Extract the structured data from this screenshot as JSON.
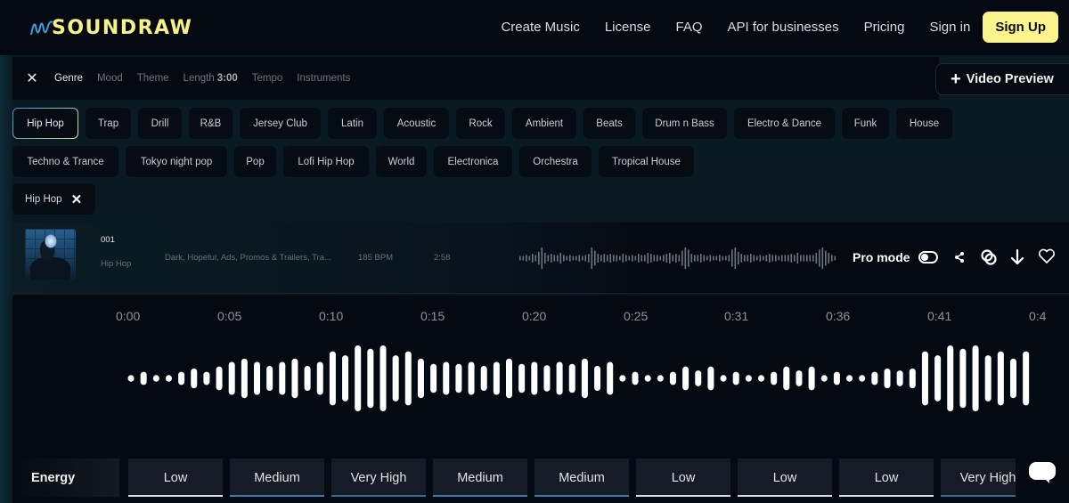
{
  "header": {
    "brand": "SOUNDRAW",
    "nav": [
      "Create Music",
      "License",
      "FAQ",
      "API for businesses",
      "Pricing",
      "Sign in"
    ],
    "signup_label": "Sign Up"
  },
  "filters": {
    "close_icon": "close-icon",
    "tabs": [
      {
        "label": "Genre",
        "active": true
      },
      {
        "label": "Mood",
        "active": false
      },
      {
        "label": "Theme",
        "active": false
      },
      {
        "label": "Length",
        "value": "3:00",
        "active": false
      },
      {
        "label": "Tempo",
        "active": false
      },
      {
        "label": "Instruments",
        "active": false
      }
    ],
    "video_preview_label": "Video Preview"
  },
  "genres": {
    "row1": [
      "Hip Hop",
      "Trap",
      "Drill",
      "R&B",
      "Jersey Club",
      "Latin",
      "Acoustic",
      "Rock",
      "Ambient",
      "Beats",
      "Drum n Bass",
      "Electro & Dance",
      "Funk",
      "House"
    ],
    "row2": [
      "Techno & Trance",
      "Tokyo night pop",
      "Pop",
      "Lofi Hip Hop",
      "World",
      "Electronica",
      "Orchestra",
      "Tropical House"
    ],
    "selected": "Hip Hop"
  },
  "selected_filter": {
    "label": "Hip Hop"
  },
  "track": {
    "id": "001",
    "genre": "Hip Hop",
    "tags": "Dark, Hopeful, Ads, Promos & Trailers, Tra...",
    "bpm": "185 BPM",
    "duration": "2:58",
    "pro_mode_label": "Pro mode",
    "pro_mode_on": false
  },
  "timeline": {
    "labels": [
      "0:00",
      "0:05",
      "0:10",
      "0:15",
      "0:20",
      "0:25",
      "0:31",
      "0:36",
      "0:41",
      "0:4"
    ]
  },
  "waveform": {
    "amplitudes": [
      0.1,
      0.2,
      0.1,
      0.1,
      0.2,
      0.3,
      0.2,
      0.36,
      0.5,
      0.6,
      0.5,
      0.38,
      0.5,
      0.6,
      0.38,
      0.5,
      0.82,
      0.7,
      1.0,
      0.9,
      1.0,
      0.7,
      0.82,
      0.6,
      0.44,
      0.5,
      0.44,
      0.5,
      0.38,
      0.5,
      0.6,
      0.44,
      0.5,
      0.4,
      0.5,
      0.44,
      0.6,
      0.38,
      0.5,
      0.1,
      0.2,
      0.1,
      0.1,
      0.2,
      0.36,
      0.24,
      0.36,
      0.1,
      0.2,
      0.1,
      0.1,
      0.2,
      0.36,
      0.24,
      0.36,
      0.1,
      0.2,
      0.1,
      0.1,
      0.2,
      0.3,
      0.24,
      0.3,
      0.82,
      0.7,
      1.0,
      0.9,
      1.0,
      0.7,
      0.82,
      0.6,
      0.82
    ],
    "mini_amplitudes": [
      0.2,
      0.2,
      0.3,
      0.2,
      0.4,
      0.3,
      0.6,
      1.0,
      0.5,
      0.3,
      0.4,
      0.3,
      0.3,
      0.5,
      0.3,
      0.2,
      0.3,
      0.2,
      0.2,
      0.3,
      0.2,
      0.3,
      0.4,
      1.0,
      0.7,
      0.4,
      0.3,
      0.4,
      0.3,
      0.4,
      0.3,
      0.3,
      0.2,
      0.4,
      0.3,
      0.2,
      0.3,
      0.2,
      0.4,
      0.3,
      0.3,
      0.5,
      0.4,
      0.3,
      0.3,
      0.2,
      0.3,
      0.4,
      0.5,
      0.3,
      0.4,
      0.3,
      0.7,
      1.0,
      0.8,
      0.4,
      0.3,
      0.3,
      0.4,
      0.3,
      0.2,
      0.3,
      0.2,
      0.2,
      0.3,
      0.2,
      0.2,
      0.3,
      0.8,
      1.0,
      0.6,
      0.4,
      0.3,
      0.3,
      0.4,
      0.3,
      0.2,
      0.3,
      0.2,
      0.3,
      0.4,
      0.3,
      0.3,
      0.2,
      0.3,
      0.3,
      0.3,
      0.4,
      0.3,
      0.5,
      0.3,
      0.3,
      0.3,
      0.3,
      0.3,
      0.5,
      0.8,
      1.0,
      0.7,
      0.5,
      0.3,
      0.2
    ]
  },
  "energy": {
    "label": "Energy",
    "cells": [
      "Low",
      "Medium",
      "Very High",
      "Medium",
      "Medium",
      "Low",
      "Low",
      "Low",
      "Very High"
    ]
  },
  "colors": {
    "brand_yellow": "#fbf48c",
    "accent_blue": "#3a7ca8",
    "background": "#050a12"
  }
}
